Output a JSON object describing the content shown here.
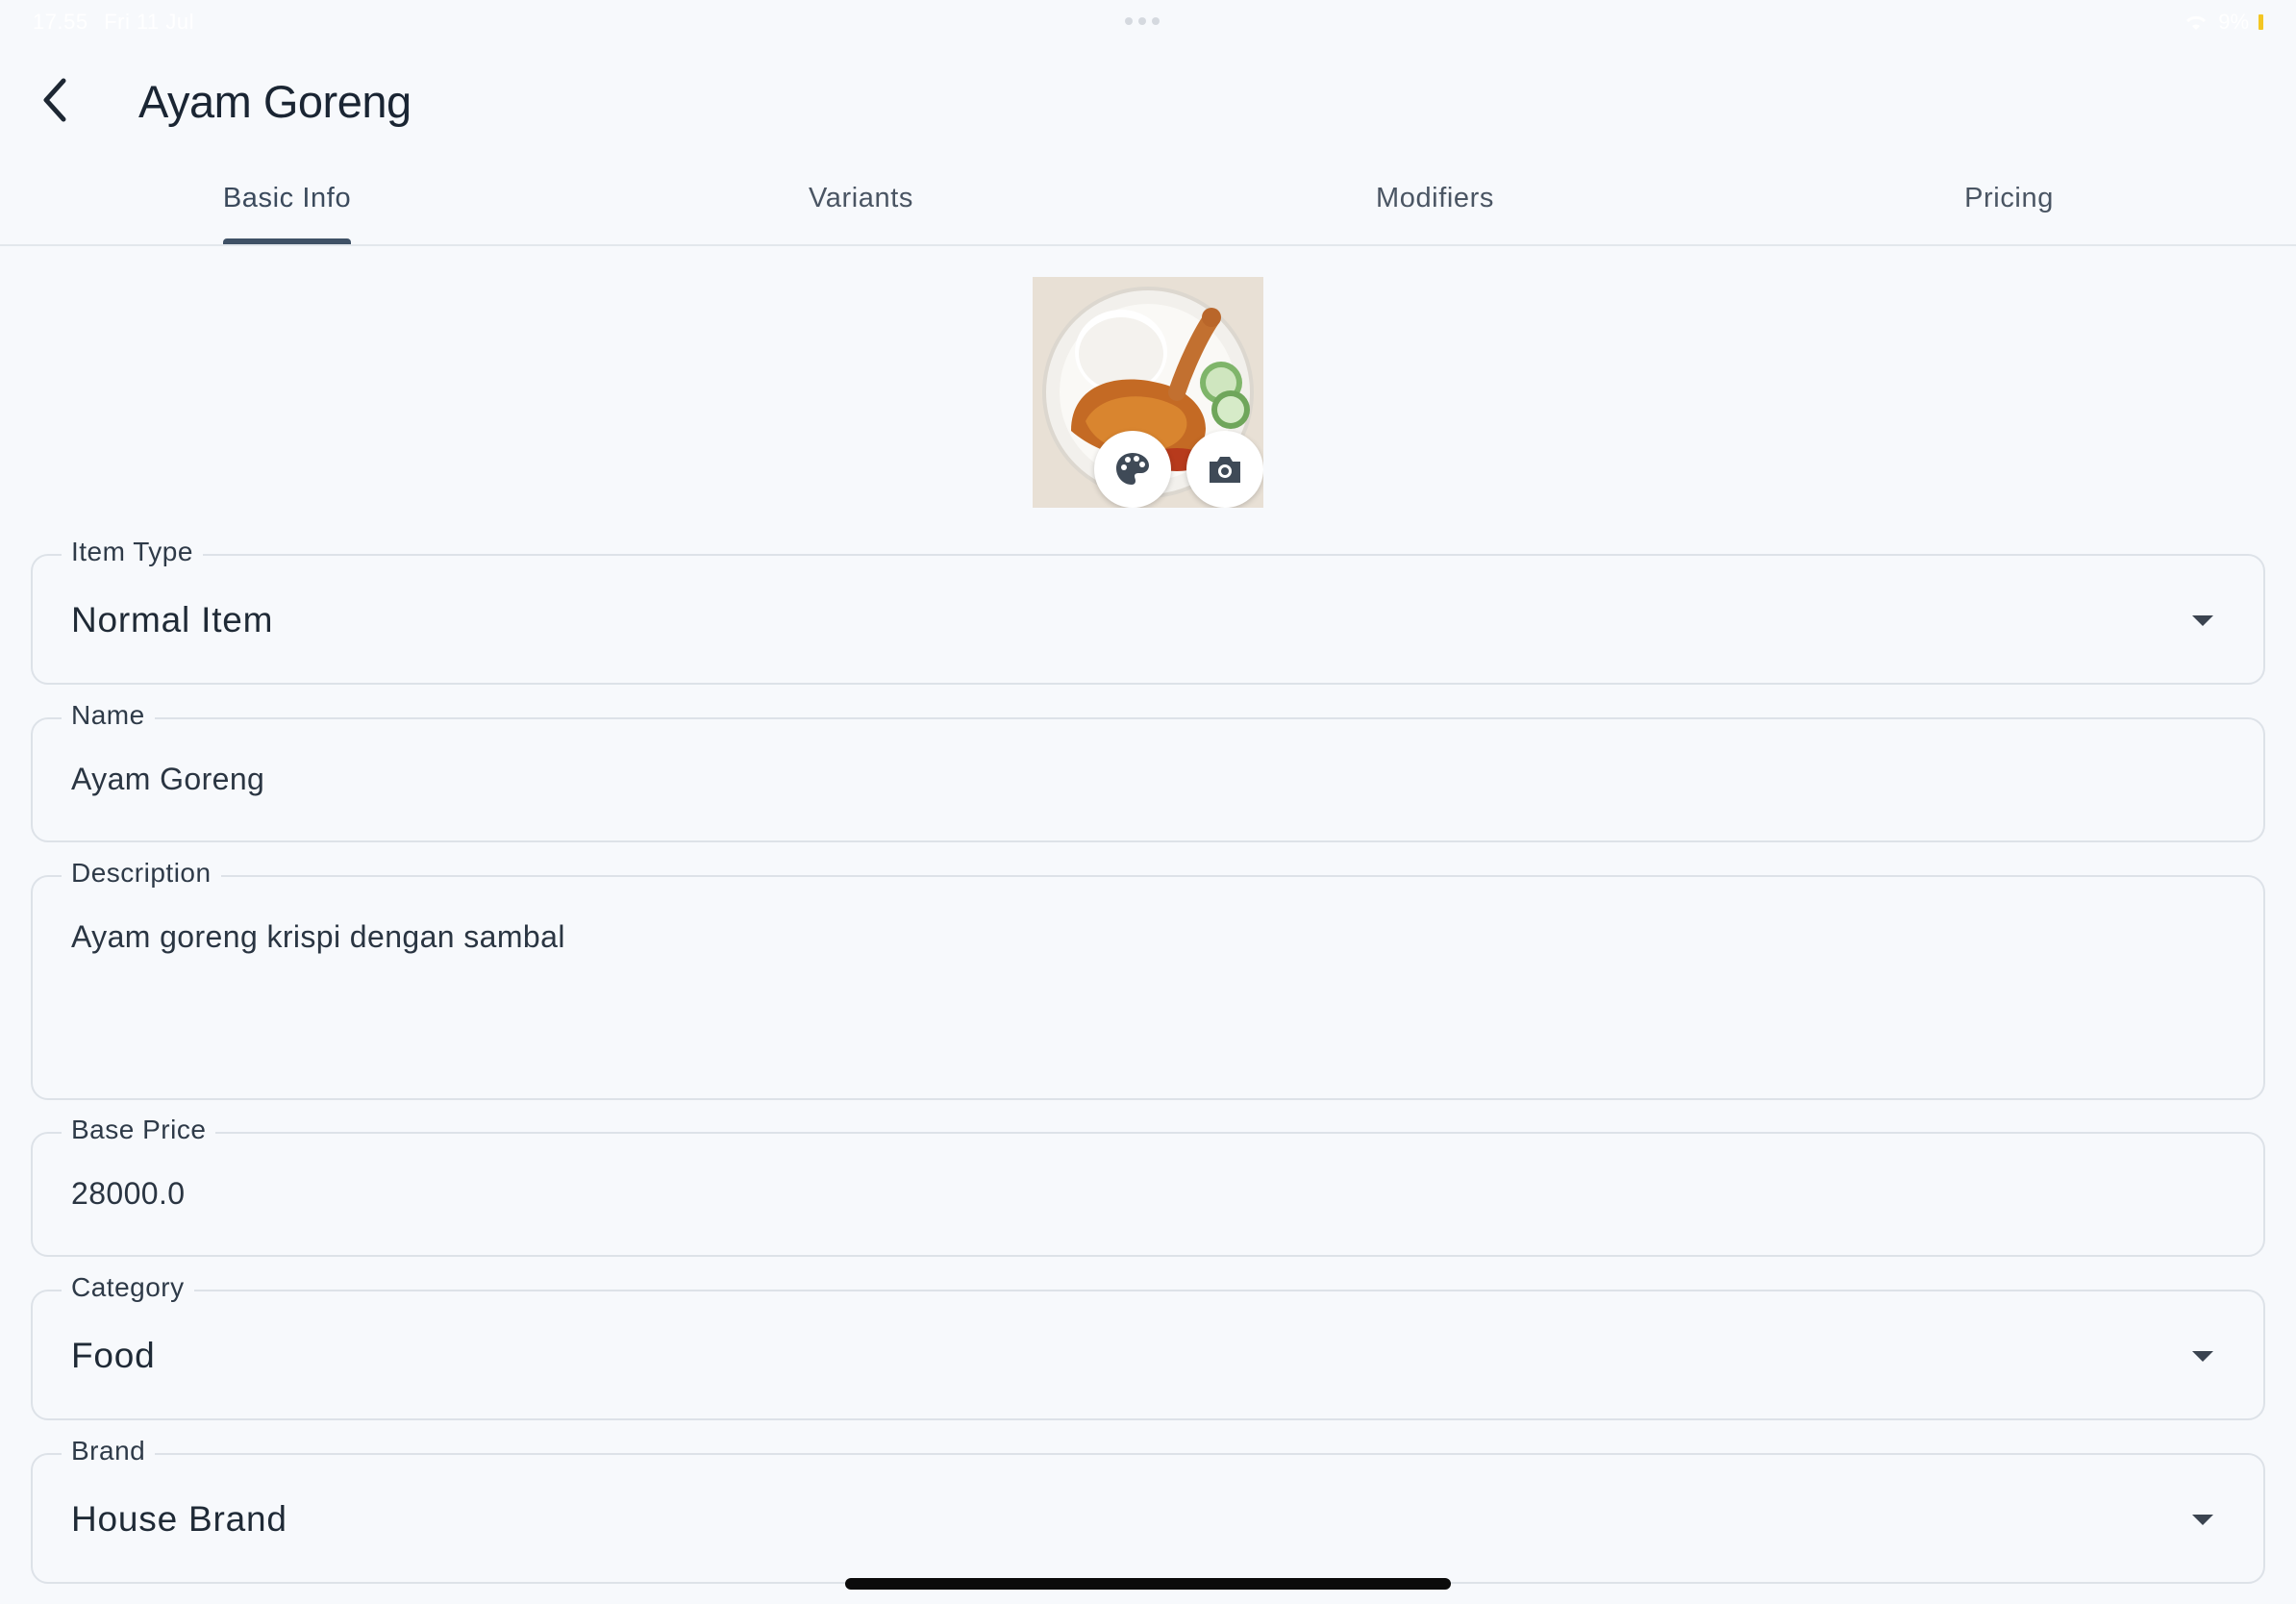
{
  "status_bar": {
    "time": "17.55",
    "date": "Fri 11 Jul",
    "battery": "9%"
  },
  "header": {
    "title": "Ayam Goreng"
  },
  "tabs": [
    {
      "label": "Basic Info",
      "active": true
    },
    {
      "label": "Variants",
      "active": false
    },
    {
      "label": "Modifiers",
      "active": false
    },
    {
      "label": "Pricing",
      "active": false
    }
  ],
  "image": {
    "actions": [
      "palette-icon",
      "camera-icon"
    ]
  },
  "form": {
    "item_type": {
      "label": "Item Type",
      "value": "Normal Item"
    },
    "name": {
      "label": "Name",
      "value": "Ayam Goreng"
    },
    "description": {
      "label": "Description",
      "value": "Ayam goreng krispi dengan sambal"
    },
    "base_price": {
      "label": "Base Price",
      "value": "28000.0"
    },
    "category": {
      "label": "Category",
      "value": "Food"
    },
    "brand": {
      "label": "Brand",
      "value": "House Brand"
    }
  },
  "colors": {
    "background": "#f7f9fc",
    "tab_indicator": "#3f5166",
    "field_border": "#dde2e8"
  }
}
